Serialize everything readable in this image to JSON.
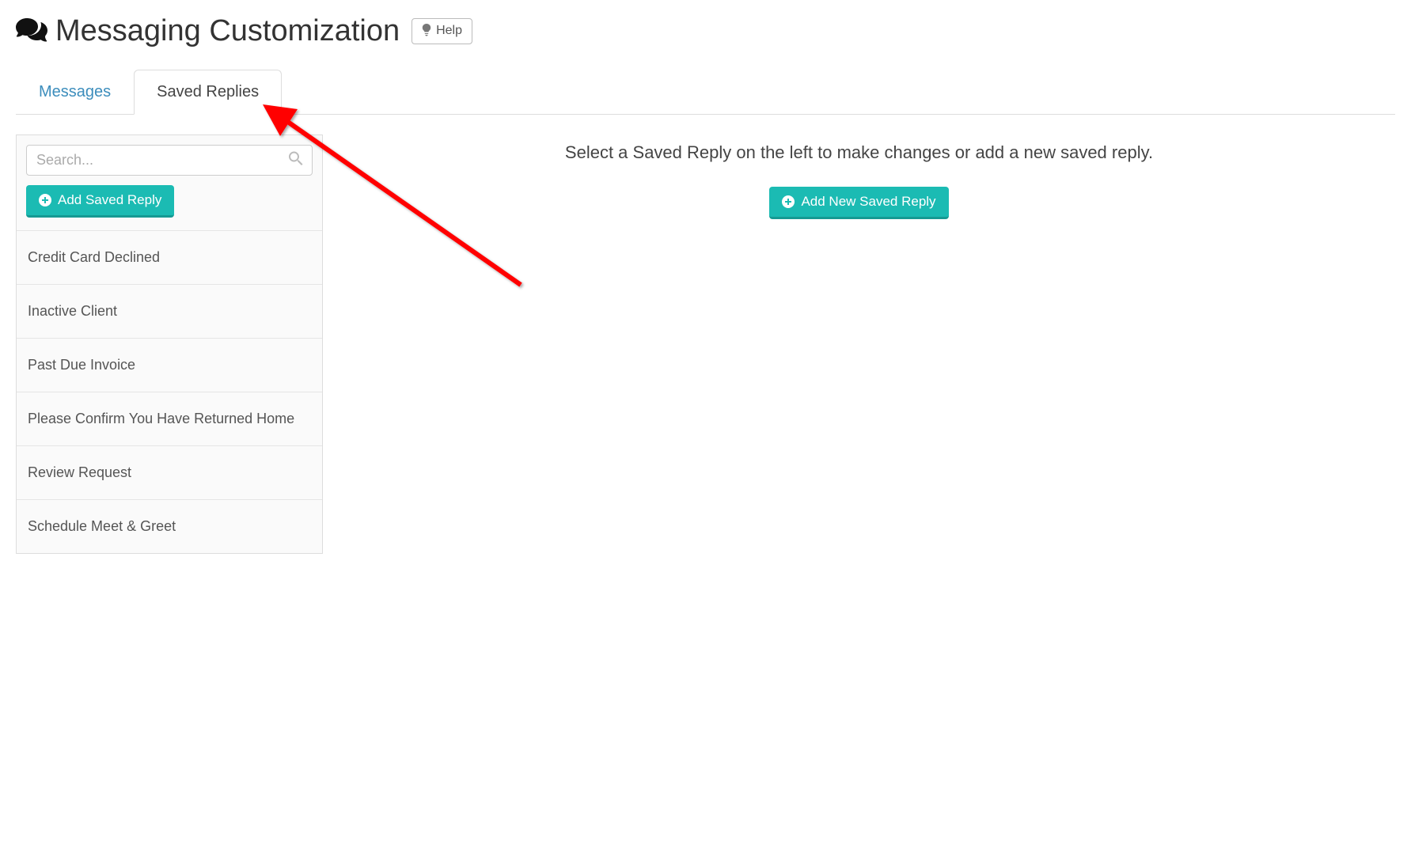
{
  "header": {
    "title": "Messaging Customization",
    "help_label": "Help"
  },
  "tabs": [
    {
      "label": "Messages",
      "active": false
    },
    {
      "label": "Saved Replies",
      "active": true
    }
  ],
  "search": {
    "placeholder": "Search..."
  },
  "sidebar": {
    "add_button_label": "Add Saved Reply",
    "items": [
      "Credit Card Declined",
      "Inactive Client",
      "Past Due Invoice",
      "Please Confirm You Have Returned Home",
      "Review Request",
      "Schedule Meet & Greet"
    ]
  },
  "main": {
    "instruction": "Select a Saved Reply on the left to make changes or add a new saved reply.",
    "add_new_button_label": "Add New Saved Reply"
  },
  "colors": {
    "teal": "#1bbbb3",
    "link": "#3c8dbc",
    "arrow": "#ff0000"
  }
}
